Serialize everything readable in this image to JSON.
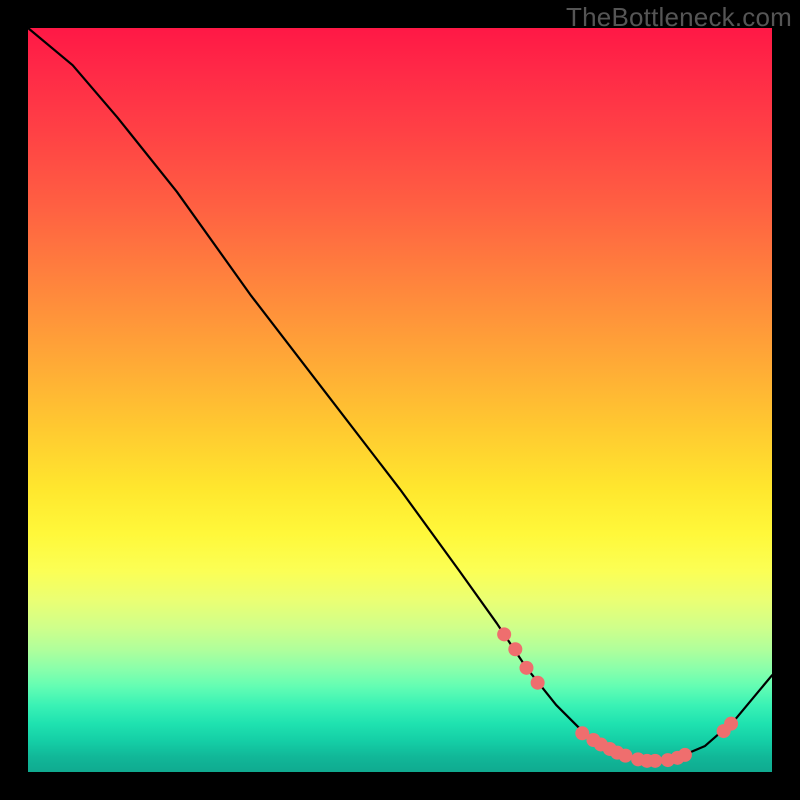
{
  "watermark": "TheBottleneck.com",
  "chart_data": {
    "type": "line",
    "title": "",
    "xlabel": "",
    "ylabel": "",
    "xlim": [
      0,
      100
    ],
    "ylim": [
      0,
      100
    ],
    "grid": false,
    "legend": false,
    "series": [
      {
        "name": "bottleneck-curve",
        "color": "#000000",
        "type": "line",
        "x": [
          0,
          6,
          12,
          20,
          30,
          40,
          50,
          58,
          63,
          67,
          71,
          75,
          79,
          83,
          87,
          91,
          95,
          100
        ],
        "y": [
          100,
          95,
          88,
          78,
          64,
          51,
          38,
          27,
          20,
          14,
          9,
          5,
          2.5,
          1.5,
          1.8,
          3.5,
          7,
          13
        ]
      }
    ],
    "markers": [
      {
        "name": "highlight-dots",
        "color": "#ef6e6e",
        "radius_px": 7,
        "points": [
          {
            "x": 64,
            "y": 18.5
          },
          {
            "x": 65.5,
            "y": 16.5
          },
          {
            "x": 67,
            "y": 14
          },
          {
            "x": 68.5,
            "y": 12
          },
          {
            "x": 74.5,
            "y": 5.2
          },
          {
            "x": 76,
            "y": 4.3
          },
          {
            "x": 77,
            "y": 3.7
          },
          {
            "x": 78.2,
            "y": 3.1
          },
          {
            "x": 79.2,
            "y": 2.6
          },
          {
            "x": 80.3,
            "y": 2.2
          },
          {
            "x": 82,
            "y": 1.7
          },
          {
            "x": 83.2,
            "y": 1.5
          },
          {
            "x": 84.3,
            "y": 1.5
          },
          {
            "x": 86,
            "y": 1.6
          },
          {
            "x": 87.3,
            "y": 1.9
          },
          {
            "x": 88.3,
            "y": 2.3
          },
          {
            "x": 93.5,
            "y": 5.5
          },
          {
            "x": 94.5,
            "y": 6.5
          }
        ]
      }
    ]
  }
}
